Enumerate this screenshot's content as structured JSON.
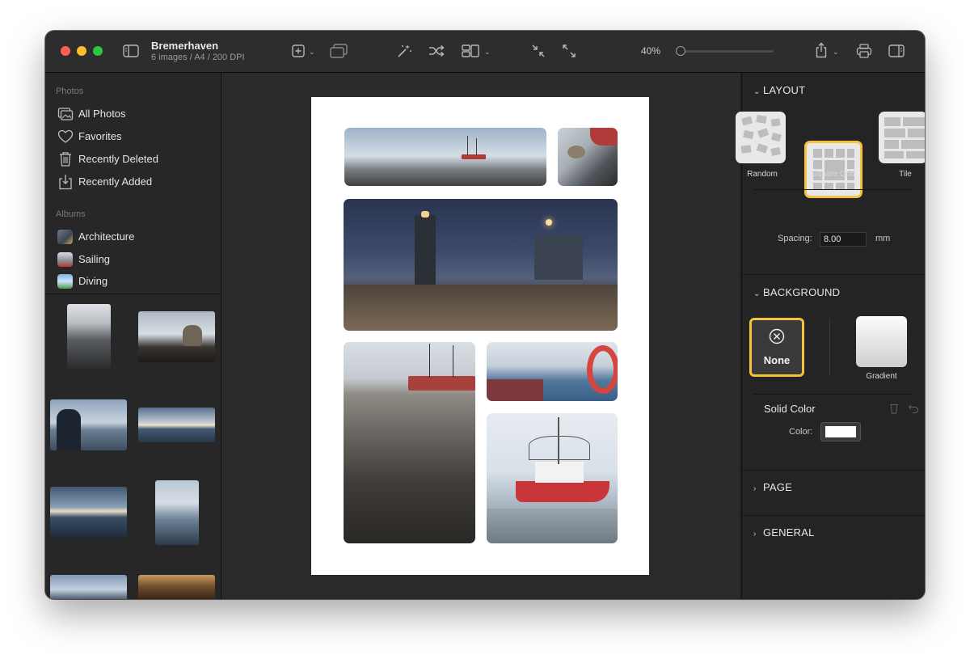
{
  "window": {
    "title": "Bremerhaven",
    "subtitle": "6 images / A4 / 200 DPI",
    "zoom_label": "40%",
    "zoom_level": 0.04
  },
  "sidebar": {
    "photos_header": "Photos",
    "photo_items": [
      {
        "label": "All Photos",
        "icon": "photos-stack-icon"
      },
      {
        "label": "Favorites",
        "icon": "heart-icon"
      },
      {
        "label": "Recently Deleted",
        "icon": "trash-icon"
      },
      {
        "label": "Recently Added",
        "icon": "download-tray-icon"
      }
    ],
    "albums_header": "Albums",
    "album_items": [
      {
        "label": "Architecture"
      },
      {
        "label": "Sailing"
      },
      {
        "label": "Diving"
      }
    ]
  },
  "inspector": {
    "layout_header": "LAYOUT",
    "layouts": [
      {
        "label": "Random"
      },
      {
        "label": "Square Grid"
      },
      {
        "label": "Tile"
      }
    ],
    "selected_layout": "Square Grid",
    "spacing_label": "Spacing:",
    "spacing_value": "8.00",
    "spacing_unit": "mm",
    "background_header": "BACKGROUND",
    "bg_none_label": "None",
    "bg_gradient_label": "Gradient",
    "solid_color_label": "Solid Color",
    "color_label": "Color:",
    "color_value": "#ffffff",
    "page_header": "PAGE",
    "general_header": "GENERAL"
  },
  "colors": {
    "accent_selection": "#f5c33b",
    "traffic_close": "#ff5f57",
    "traffic_min": "#febc2e",
    "traffic_max": "#28c840"
  }
}
